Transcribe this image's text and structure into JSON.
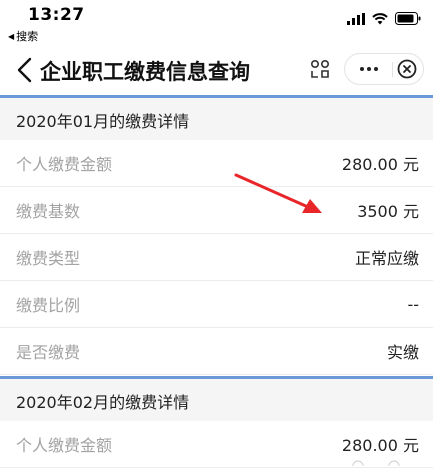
{
  "status_bar": {
    "time": "13:27",
    "back_app_label": "搜索",
    "icons": [
      "signal-icon",
      "wifi-icon",
      "battery-icon"
    ]
  },
  "nav": {
    "title": "企业职工缴费信息查询",
    "icons": [
      "back-chevron-icon",
      "scan-icon",
      "more-icon",
      "close-icon"
    ]
  },
  "sections": [
    {
      "title": "2020年01月的缴费详情",
      "rows": [
        {
          "label": "个人缴费金额",
          "value": "280.00 元"
        },
        {
          "label": "缴费基数",
          "value": "3500 元"
        },
        {
          "label": "缴费类型",
          "value": "正常应缴"
        },
        {
          "label": "缴费比例",
          "value": "--"
        },
        {
          "label": "是否缴费",
          "value": "实缴"
        }
      ]
    },
    {
      "title": "2020年02月的缴费详情",
      "rows": [
        {
          "label": "个人缴费金额",
          "value": "280.00 元"
        }
      ]
    }
  ],
  "annotation": {
    "arrow_color": "#e8262a"
  },
  "colors": {
    "accent_line": "#6a98d9",
    "section_bg": "#f5f5f5",
    "label": "#a3a3a3",
    "value": "#222222"
  }
}
